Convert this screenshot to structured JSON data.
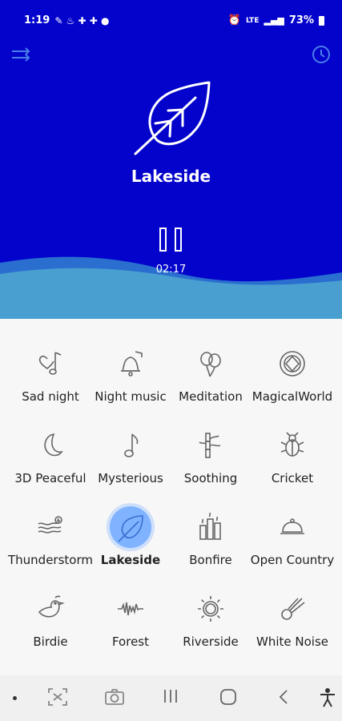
{
  "status": {
    "time": "1:19",
    "lte": "LTE",
    "battery": "73%"
  },
  "header": {
    "menu_icon": "shuffle-icon",
    "timer_icon": "clock-icon"
  },
  "now_playing": {
    "title": "Lakeside",
    "elapsed": "02:17",
    "icon": "leaf-icon",
    "state": "paused"
  },
  "sounds": [
    {
      "label": "Sad night",
      "icon": "heart-music-icon"
    },
    {
      "label": "Night music",
      "icon": "bell-music-icon"
    },
    {
      "label": "Meditation",
      "icon": "balloons-icon"
    },
    {
      "label": "MagicalWorld",
      "icon": "gem-icon"
    },
    {
      "label": "3D Peaceful",
      "icon": "moon-icon"
    },
    {
      "label": "Mysterious",
      "icon": "music-note-icon"
    },
    {
      "label": "Soothing",
      "icon": "bamboo-icon"
    },
    {
      "label": "Cricket",
      "icon": "bug-icon"
    },
    {
      "label": "Thunderstorm",
      "icon": "storm-icon"
    },
    {
      "label": "Lakeside",
      "icon": "leaf-icon"
    },
    {
      "label": "Bonfire",
      "icon": "candles-icon"
    },
    {
      "label": "Open Country",
      "icon": "cloche-icon"
    },
    {
      "label": "Birdie",
      "icon": "bird-icon"
    },
    {
      "label": "Forest",
      "icon": "waveform-icon"
    },
    {
      "label": "Riverside",
      "icon": "sun-icon"
    },
    {
      "label": "White Noise",
      "icon": "comet-icon"
    }
  ],
  "selected": "Lakeside",
  "colors": {
    "hero": "#0303cc",
    "wave_light": "#4a9fd1",
    "highlight": "#7fb2ff"
  }
}
